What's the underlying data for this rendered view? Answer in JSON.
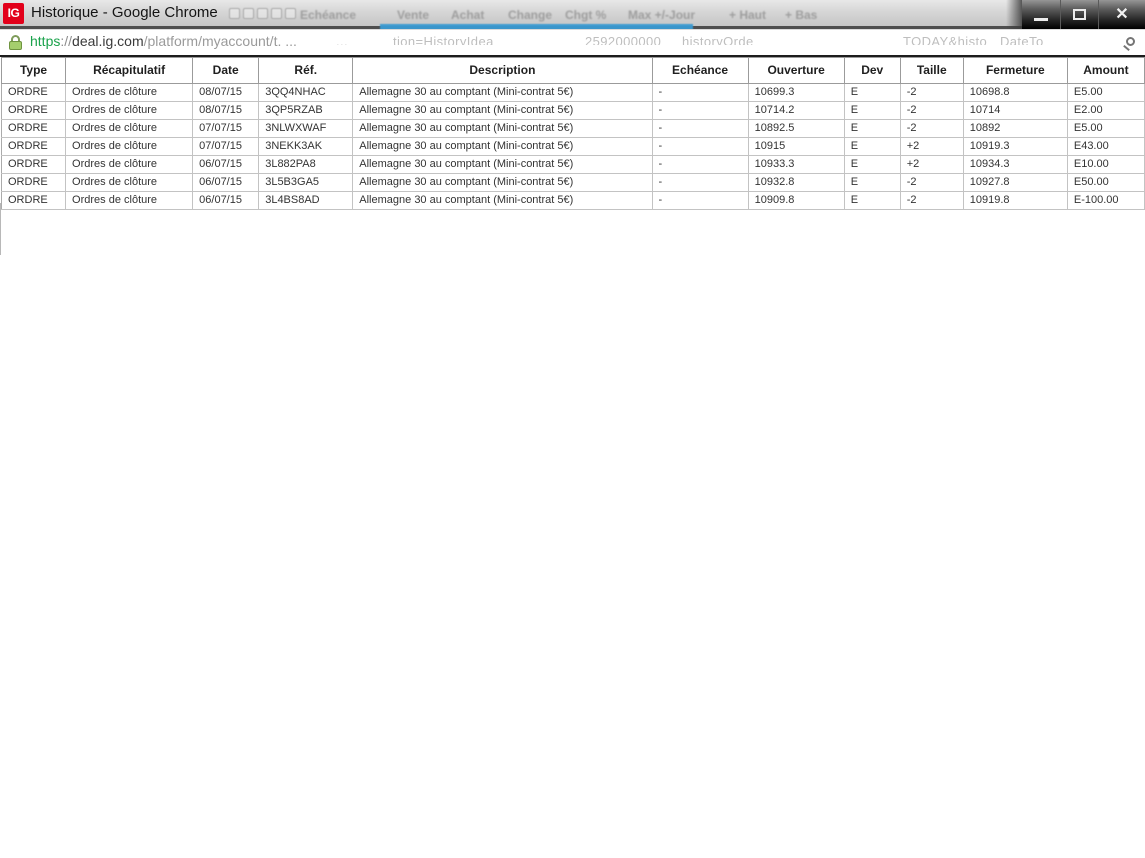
{
  "window": {
    "title": "Historique - Google Chrome",
    "favicon_text": "IG",
    "controls": {
      "close_glyph": "✕"
    }
  },
  "titlebar_ghosts": [
    "Echéance",
    "Vente",
    "Achat",
    "Change",
    "Chgt %",
    "Max +/-Jour",
    "+ Haut",
    "+ Bas"
  ],
  "urlbar": {
    "scheme": "https",
    "separator": "://",
    "domain": "deal.ig.com",
    "path": "/platform/myaccount/t. ...",
    "ghost_fragments": [
      "...",
      "tion=HistoryIdea",
      "2592000000",
      "historyOrde",
      "TODAY&histo",
      "DateTo"
    ]
  },
  "table": {
    "columns": [
      "Type",
      "Récapitulatif",
      "Date",
      "Réf.",
      "Description",
      "Echéance",
      "Ouverture",
      "Dev",
      "Taille",
      "Fermeture",
      "Amount"
    ],
    "rows": [
      [
        "ORDRE",
        "Ordres de clôture",
        "08/07/15",
        "3QQ4NHAC",
        "Allemagne 30 au comptant (Mini-contrat 5€)",
        "-",
        "10699.3",
        "E",
        "-2",
        "10698.8",
        "E5.00"
      ],
      [
        "ORDRE",
        "Ordres de clôture",
        "08/07/15",
        "3QP5RZAB",
        "Allemagne 30 au comptant (Mini-contrat 5€)",
        "-",
        "10714.2",
        "E",
        "-2",
        "10714",
        "E2.00"
      ],
      [
        "ORDRE",
        "Ordres de clôture",
        "07/07/15",
        "3NLWXWAF",
        "Allemagne 30 au comptant (Mini-contrat 5€)",
        "-",
        "10892.5",
        "E",
        "-2",
        "10892",
        "E5.00"
      ],
      [
        "ORDRE",
        "Ordres de clôture",
        "07/07/15",
        "3NEKK3AK",
        "Allemagne 30 au comptant (Mini-contrat 5€)",
        "-",
        "10915",
        "E",
        "+2",
        "10919.3",
        "E43.00"
      ],
      [
        "ORDRE",
        "Ordres de clôture",
        "06/07/15",
        "3L882PA8",
        "Allemagne 30 au comptant (Mini-contrat 5€)",
        "-",
        "10933.3",
        "E",
        "+2",
        "10934.3",
        "E10.00"
      ],
      [
        "ORDRE",
        "Ordres de clôture",
        "06/07/15",
        "3L5B3GA5",
        "Allemagne 30 au comptant (Mini-contrat 5€)",
        "-",
        "10932.8",
        "E",
        "-2",
        "10927.8",
        "E50.00"
      ],
      [
        "ORDRE",
        "Ordres de clôture",
        "06/07/15",
        "3L4BS8AD",
        "Allemagne 30 au comptant (Mini-contrat 5€)",
        "-",
        "10909.8",
        "E",
        "-2",
        "10919.8",
        "E-100.00"
      ]
    ]
  },
  "colors": {
    "brand_red": "#e2001a",
    "https_green": "#1aa24b",
    "accent_blue": "#3a9ad2"
  }
}
